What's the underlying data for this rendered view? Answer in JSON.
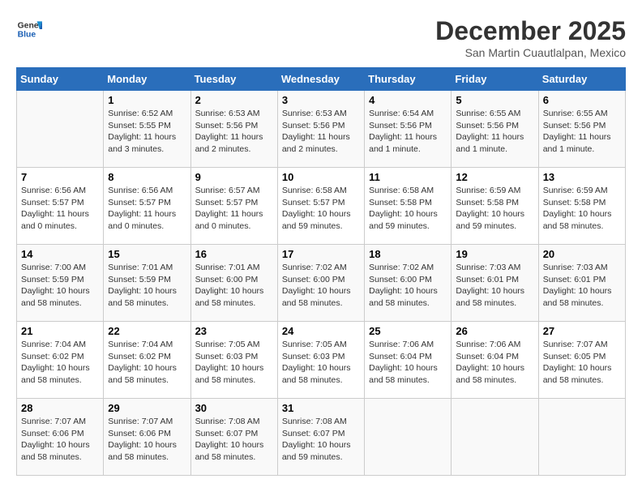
{
  "header": {
    "logo_line1": "General",
    "logo_line2": "Blue",
    "month": "December 2025",
    "location": "San Martin Cuautlalpan, Mexico"
  },
  "weekdays": [
    "Sunday",
    "Monday",
    "Tuesday",
    "Wednesday",
    "Thursday",
    "Friday",
    "Saturday"
  ],
  "weeks": [
    [
      {
        "day": "",
        "info": ""
      },
      {
        "day": "1",
        "info": "Sunrise: 6:52 AM\nSunset: 5:55 PM\nDaylight: 11 hours\nand 3 minutes."
      },
      {
        "day": "2",
        "info": "Sunrise: 6:53 AM\nSunset: 5:56 PM\nDaylight: 11 hours\nand 2 minutes."
      },
      {
        "day": "3",
        "info": "Sunrise: 6:53 AM\nSunset: 5:56 PM\nDaylight: 11 hours\nand 2 minutes."
      },
      {
        "day": "4",
        "info": "Sunrise: 6:54 AM\nSunset: 5:56 PM\nDaylight: 11 hours\nand 1 minute."
      },
      {
        "day": "5",
        "info": "Sunrise: 6:55 AM\nSunset: 5:56 PM\nDaylight: 11 hours\nand 1 minute."
      },
      {
        "day": "6",
        "info": "Sunrise: 6:55 AM\nSunset: 5:56 PM\nDaylight: 11 hours\nand 1 minute."
      }
    ],
    [
      {
        "day": "7",
        "info": "Sunrise: 6:56 AM\nSunset: 5:57 PM\nDaylight: 11 hours\nand 0 minutes."
      },
      {
        "day": "8",
        "info": "Sunrise: 6:56 AM\nSunset: 5:57 PM\nDaylight: 11 hours\nand 0 minutes."
      },
      {
        "day": "9",
        "info": "Sunrise: 6:57 AM\nSunset: 5:57 PM\nDaylight: 11 hours\nand 0 minutes."
      },
      {
        "day": "10",
        "info": "Sunrise: 6:58 AM\nSunset: 5:57 PM\nDaylight: 10 hours\nand 59 minutes."
      },
      {
        "day": "11",
        "info": "Sunrise: 6:58 AM\nSunset: 5:58 PM\nDaylight: 10 hours\nand 59 minutes."
      },
      {
        "day": "12",
        "info": "Sunrise: 6:59 AM\nSunset: 5:58 PM\nDaylight: 10 hours\nand 59 minutes."
      },
      {
        "day": "13",
        "info": "Sunrise: 6:59 AM\nSunset: 5:58 PM\nDaylight: 10 hours\nand 58 minutes."
      }
    ],
    [
      {
        "day": "14",
        "info": "Sunrise: 7:00 AM\nSunset: 5:59 PM\nDaylight: 10 hours\nand 58 minutes."
      },
      {
        "day": "15",
        "info": "Sunrise: 7:01 AM\nSunset: 5:59 PM\nDaylight: 10 hours\nand 58 minutes."
      },
      {
        "day": "16",
        "info": "Sunrise: 7:01 AM\nSunset: 6:00 PM\nDaylight: 10 hours\nand 58 minutes."
      },
      {
        "day": "17",
        "info": "Sunrise: 7:02 AM\nSunset: 6:00 PM\nDaylight: 10 hours\nand 58 minutes."
      },
      {
        "day": "18",
        "info": "Sunrise: 7:02 AM\nSunset: 6:00 PM\nDaylight: 10 hours\nand 58 minutes."
      },
      {
        "day": "19",
        "info": "Sunrise: 7:03 AM\nSunset: 6:01 PM\nDaylight: 10 hours\nand 58 minutes."
      },
      {
        "day": "20",
        "info": "Sunrise: 7:03 AM\nSunset: 6:01 PM\nDaylight: 10 hours\nand 58 minutes."
      }
    ],
    [
      {
        "day": "21",
        "info": "Sunrise: 7:04 AM\nSunset: 6:02 PM\nDaylight: 10 hours\nand 58 minutes."
      },
      {
        "day": "22",
        "info": "Sunrise: 7:04 AM\nSunset: 6:02 PM\nDaylight: 10 hours\nand 58 minutes."
      },
      {
        "day": "23",
        "info": "Sunrise: 7:05 AM\nSunset: 6:03 PM\nDaylight: 10 hours\nand 58 minutes."
      },
      {
        "day": "24",
        "info": "Sunrise: 7:05 AM\nSunset: 6:03 PM\nDaylight: 10 hours\nand 58 minutes."
      },
      {
        "day": "25",
        "info": "Sunrise: 7:06 AM\nSunset: 6:04 PM\nDaylight: 10 hours\nand 58 minutes."
      },
      {
        "day": "26",
        "info": "Sunrise: 7:06 AM\nSunset: 6:04 PM\nDaylight: 10 hours\nand 58 minutes."
      },
      {
        "day": "27",
        "info": "Sunrise: 7:07 AM\nSunset: 6:05 PM\nDaylight: 10 hours\nand 58 minutes."
      }
    ],
    [
      {
        "day": "28",
        "info": "Sunrise: 7:07 AM\nSunset: 6:06 PM\nDaylight: 10 hours\nand 58 minutes."
      },
      {
        "day": "29",
        "info": "Sunrise: 7:07 AM\nSunset: 6:06 PM\nDaylight: 10 hours\nand 58 minutes."
      },
      {
        "day": "30",
        "info": "Sunrise: 7:08 AM\nSunset: 6:07 PM\nDaylight: 10 hours\nand 58 minutes."
      },
      {
        "day": "31",
        "info": "Sunrise: 7:08 AM\nSunset: 6:07 PM\nDaylight: 10 hours\nand 59 minutes."
      },
      {
        "day": "",
        "info": ""
      },
      {
        "day": "",
        "info": ""
      },
      {
        "day": "",
        "info": ""
      }
    ]
  ]
}
